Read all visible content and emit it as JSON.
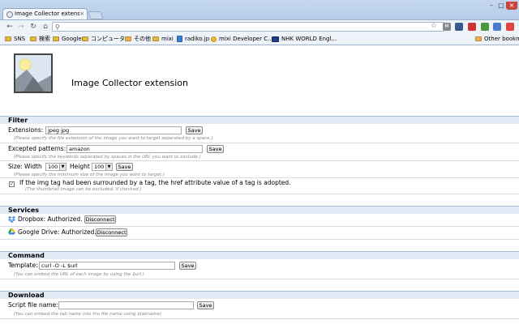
{
  "browser": {
    "tab_title": "Image Collector extension",
    "tab_close": "×",
    "bookmarks": [
      {
        "label": "SNS",
        "icon": "folder-icon"
      },
      {
        "label": "検索",
        "icon": "folder-icon"
      },
      {
        "label": "Google",
        "icon": "folder-icon"
      },
      {
        "label": "コンピュータ",
        "icon": "folder-icon"
      },
      {
        "label": "その他",
        "icon": "folder-icon"
      },
      {
        "label": "mixi",
        "icon": "folder-icon"
      },
      {
        "label": "radiko.jp",
        "icon": "page-icon"
      },
      {
        "label": "mixi Developer C...",
        "icon": "mixi-icon"
      },
      {
        "label": "NHK WORLD Engl...",
        "icon": "nhk-icon"
      }
    ],
    "other_bookmarks": "Other bookmarks"
  },
  "header": {
    "title": "Image Collector extension"
  },
  "filter": {
    "heading": "Filter",
    "extensions_label": "Extensions:",
    "extensions_value": "jpeg jpg",
    "extensions_hint": "(Please specify the file extension of the image you want to target separated by a space.)",
    "excepted_label": "Excepted patterns:",
    "excepted_value": "amazon",
    "excepted_hint": "(Please specify the keywords separated by spaces in the URL you want to exclude.)",
    "size_label": "Size:",
    "width_label": "Width",
    "width_value": "100",
    "height_label": "Height",
    "height_value": "100",
    "size_hint": "(Please specify the minimum size of the image you want to target.)",
    "img_tag_label": "If the img tag had been surrounded by a tag, the href attribute value of a tag is adopted.",
    "img_tag_hint": "(The thumbnail image can be excluded, if checked.)",
    "img_tag_checked": true,
    "save_label": "Save"
  },
  "services": {
    "heading": "Services",
    "dropbox_label": "Dropbox: Authorized.",
    "dropbox_button": "Disconnect",
    "gdrive_label": "Google Drive: Authorized.",
    "gdrive_button": "Disconnect"
  },
  "command": {
    "heading": "Command",
    "template_label": "Template:",
    "template_value": "curl -O -L $url",
    "template_hint": "(You can embed the URL of each image by using the $url.)",
    "save_label": "Save"
  },
  "download": {
    "heading": "Download",
    "script_label": "Script file name:",
    "script_value": "",
    "script_hint": "(You can embed the tab name into the file name using $tabname)",
    "save_label": "Save"
  }
}
